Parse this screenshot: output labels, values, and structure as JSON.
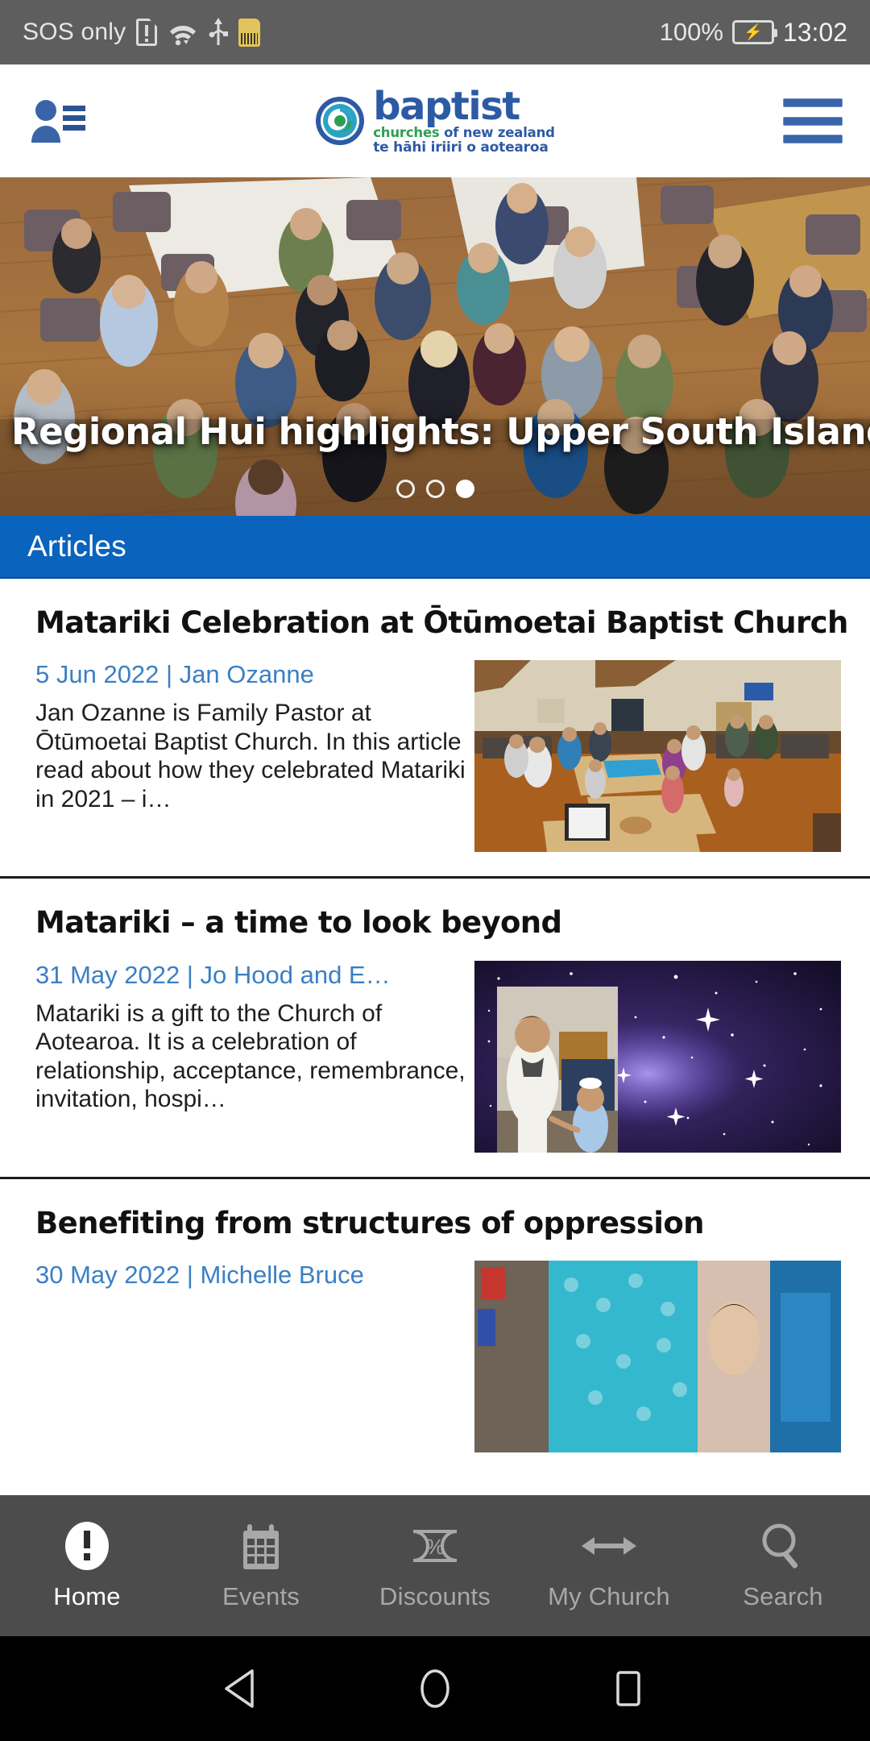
{
  "status_bar": {
    "carrier": "SOS only",
    "battery_percent": "100%",
    "clock": "13:02",
    "icons": [
      "sim-card-alert-icon",
      "wifi-icon",
      "usb-icon",
      "sd-card-icon",
      "battery-charging-icon"
    ]
  },
  "header": {
    "contacts_icon": "contacts-person-list-icon",
    "menu_icon": "hamburger-menu-icon",
    "logo": {
      "mark": "baptist-koru-spiral-logo-icon",
      "word": "baptist",
      "line2_left": "churches",
      "line2_right": "of new zealand",
      "line3": "te hāhi iriiri o aotearoa"
    }
  },
  "hero": {
    "title": "Regional Hui highlights: Upper South Island",
    "slide_count": 3,
    "active_slide": 3,
    "image_alt": "People standing in a circle praying in a wooden-floored church hall"
  },
  "section": {
    "title": "Articles"
  },
  "articles": [
    {
      "title": "Matariki Celebration at Ōtūmoetai Baptist Church",
      "date": "5 Jun 2022",
      "separator": "|",
      "author": "Jan Ozanne",
      "meta": "5 Jun 2022 | Jan Ozanne",
      "excerpt": "Jan Ozanne is Family Pastor at Ōtūmoetai Baptist Church. In this article read about how they celebrated Matariki in 2021 – i…",
      "thumb_alt": "Church hall interior with families gathered around tables"
    },
    {
      "title": "Matariki – a time to look beyond",
      "date": "31 May 2022",
      "separator": "|",
      "author": "Jo Hood and E…",
      "meta": "31 May 2022 | Jo Hood and E…",
      "excerpt": "Matariki is a gift to the Church of Aotearoa. It is a celebration of relationship, acceptance, remembrance, invitation, hospi…",
      "thumb_alt": "Woman holding a child's hand against a purple starfield"
    },
    {
      "title": "Benefiting from structures of oppression",
      "date": "30 May 2022",
      "separator": "|",
      "author": "Michelle Bruce",
      "meta": "30 May 2022 | Michelle Bruce",
      "excerpt": "",
      "thumb_alt": "Photo collage with teal patterned fabric"
    }
  ],
  "tabbar": {
    "items": [
      {
        "label": "Home",
        "icon": "exclamation-circle-icon",
        "active": true
      },
      {
        "label": "Events",
        "icon": "calendar-icon",
        "active": false
      },
      {
        "label": "Discounts",
        "icon": "percent-tag-icon",
        "active": false
      },
      {
        "label": "My Church",
        "icon": "double-arrow-icon",
        "active": false
      },
      {
        "label": "Search",
        "icon": "magnifier-icon",
        "active": false
      }
    ]
  },
  "navbar": {
    "back": "back-triangle-icon",
    "home": "home-circle-icon",
    "recents": "recents-square-icon"
  },
  "colors": {
    "status_bar_bg": "#5e5e5e",
    "brand_blue": "#2d5aa5",
    "brand_green": "#2e9e53",
    "section_blue": "#0a63bd",
    "meta_link_blue": "#3b7fc4",
    "tabbar_bg": "#4c4c4c",
    "navbar_bg": "#000000"
  }
}
